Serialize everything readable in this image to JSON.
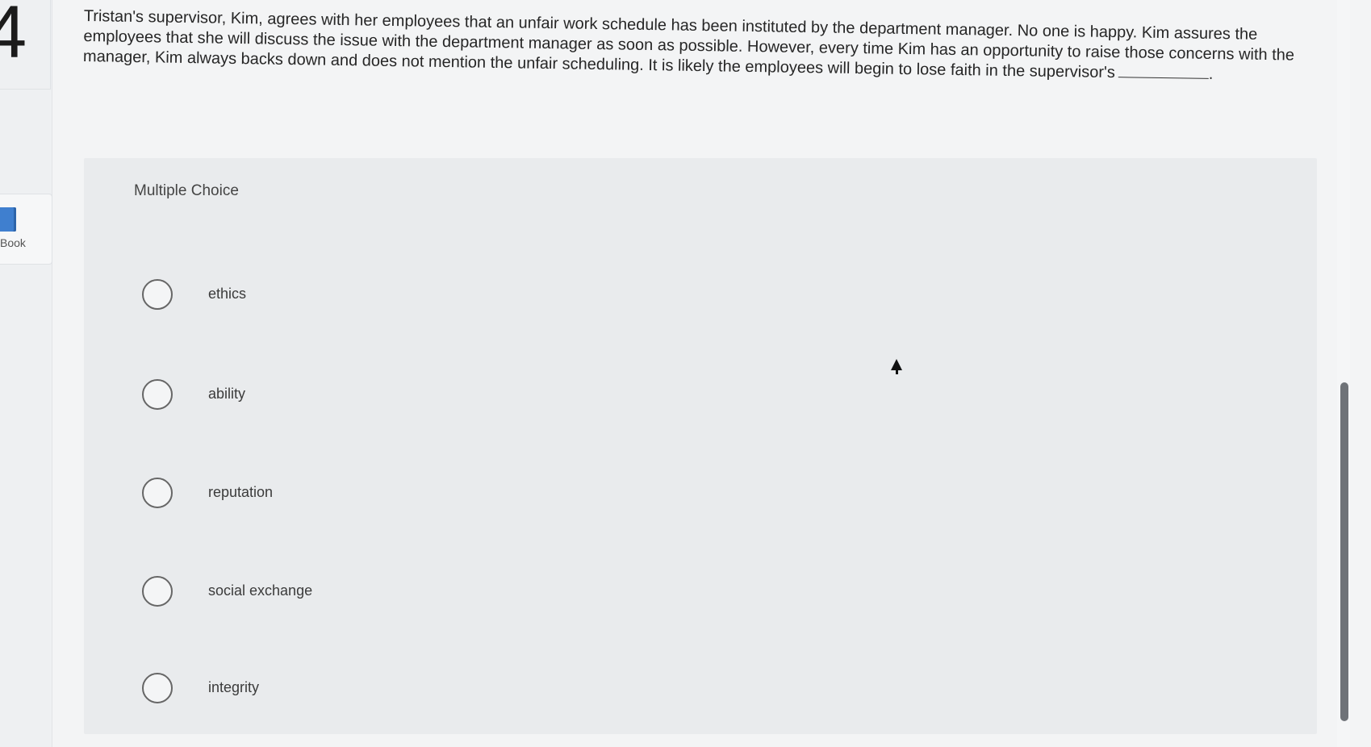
{
  "question": {
    "number": "4",
    "text": "Tristan's supervisor, Kim, agrees with her employees that an unfair work schedule has been instituted by the department manager. No one is happy. Kim assures the employees that she will discuss the issue with the department manager as soon as possible. However, every time Kim has an opportunity to raise those concerns with the manager, Kim always backs down and does not mention the unfair scheduling. It is likely the employees will begin to lose faith in the supervisor's",
    "blank_suffix": "."
  },
  "sidebar": {
    "ebook_label": "Book"
  },
  "choices": {
    "header": "Multiple Choice",
    "options": [
      {
        "label": "ethics"
      },
      {
        "label": "ability"
      },
      {
        "label": "reputation"
      },
      {
        "label": "social exchange"
      },
      {
        "label": "integrity"
      }
    ]
  },
  "icons": {
    "ebook": "ebook-icon",
    "radio": "radio-button-icon",
    "cursor": "mouse-pointer-icon"
  },
  "colors": {
    "page_background": "#f3f4f5",
    "panel_background": "#e9ebed",
    "ebook_accent": "#3f7fcf"
  }
}
